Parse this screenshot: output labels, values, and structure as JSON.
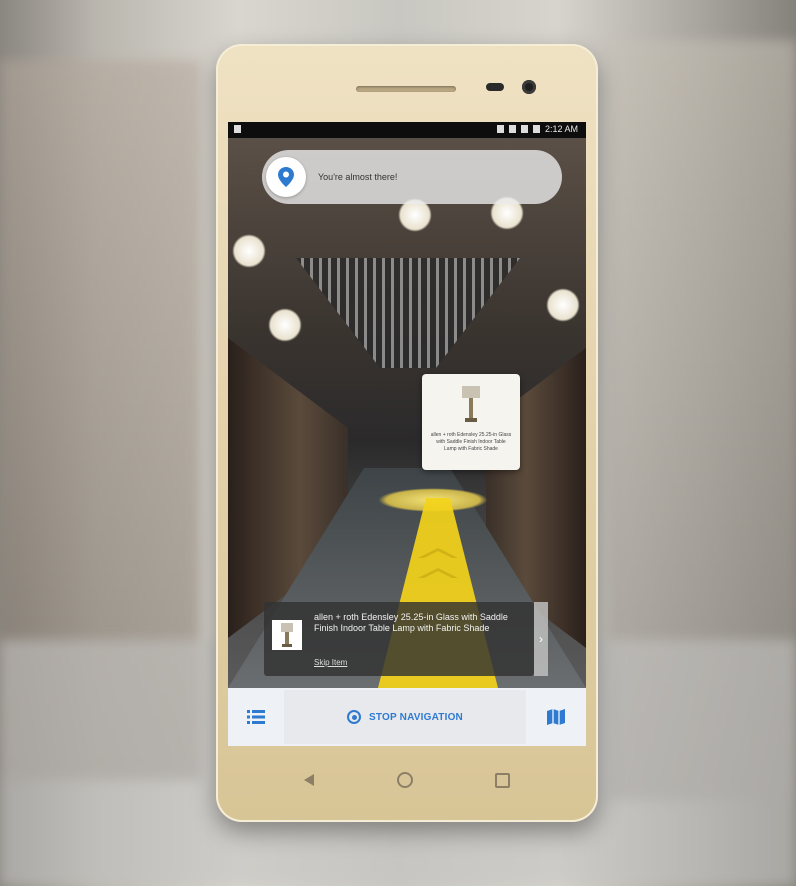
{
  "status_bar": {
    "time": "2:12 AM"
  },
  "toast": {
    "text": "You're almost there!",
    "icon": "location-pin-icon"
  },
  "ar_card": {
    "text": "allen + roth Edensley 25.25-in Glass with Saddle Finish Indoor Table Lamp with Fabric Shade"
  },
  "product_card": {
    "title": "allen + roth Edensley 25.25-in Glass with Saddle Finish Indoor Table Lamp with Fabric Shade",
    "skip_label": "Skip Item",
    "next_icon": "chevron-right-icon",
    "next_glyph": "›"
  },
  "bottom_bar": {
    "list_icon": "list-icon",
    "stop_label": "STOP NAVIGATION",
    "stop_icon": "stop-circle-icon",
    "map_icon": "map-icon"
  },
  "nav_bar": {
    "back": "back-icon",
    "home": "home-icon",
    "recents": "recents-icon"
  },
  "colors": {
    "accent_blue": "#2f7ad1",
    "path_yellow": "#f3d31a",
    "phone_gold": "#e3d1aa"
  }
}
